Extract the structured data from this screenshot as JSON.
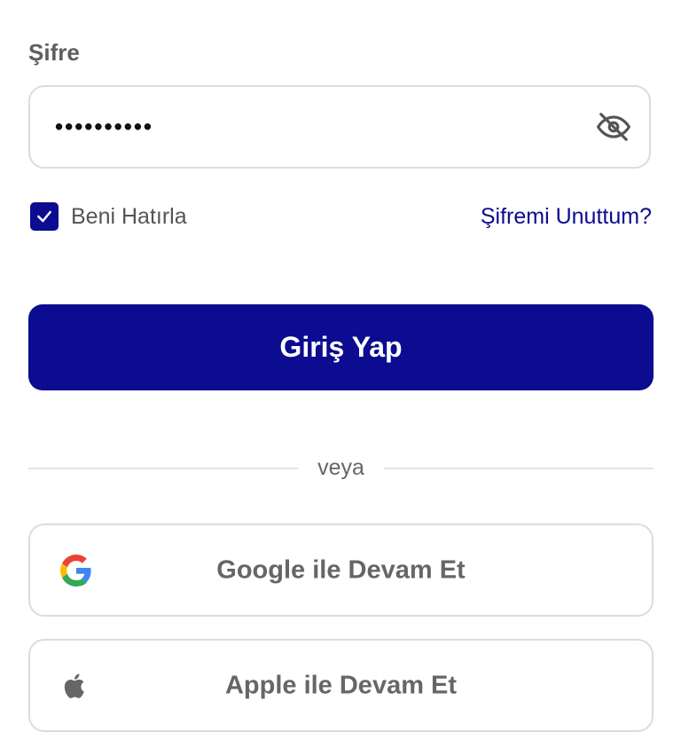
{
  "password": {
    "label": "Şifre",
    "value": "••••••••••",
    "toggle_icon": "eye-off-icon"
  },
  "remember": {
    "label": "Beni Hatırla",
    "checked": true
  },
  "forgot_link": "Şifremi Unuttum?",
  "login_button": "Giriş Yap",
  "divider_text": "veya",
  "social": {
    "google_label": "Google ile Devam Et",
    "apple_label": "Apple ile Devam Et"
  },
  "colors": {
    "primary": "#0b0c8f",
    "border": "#dcdcdc",
    "muted_text": "#666666"
  }
}
